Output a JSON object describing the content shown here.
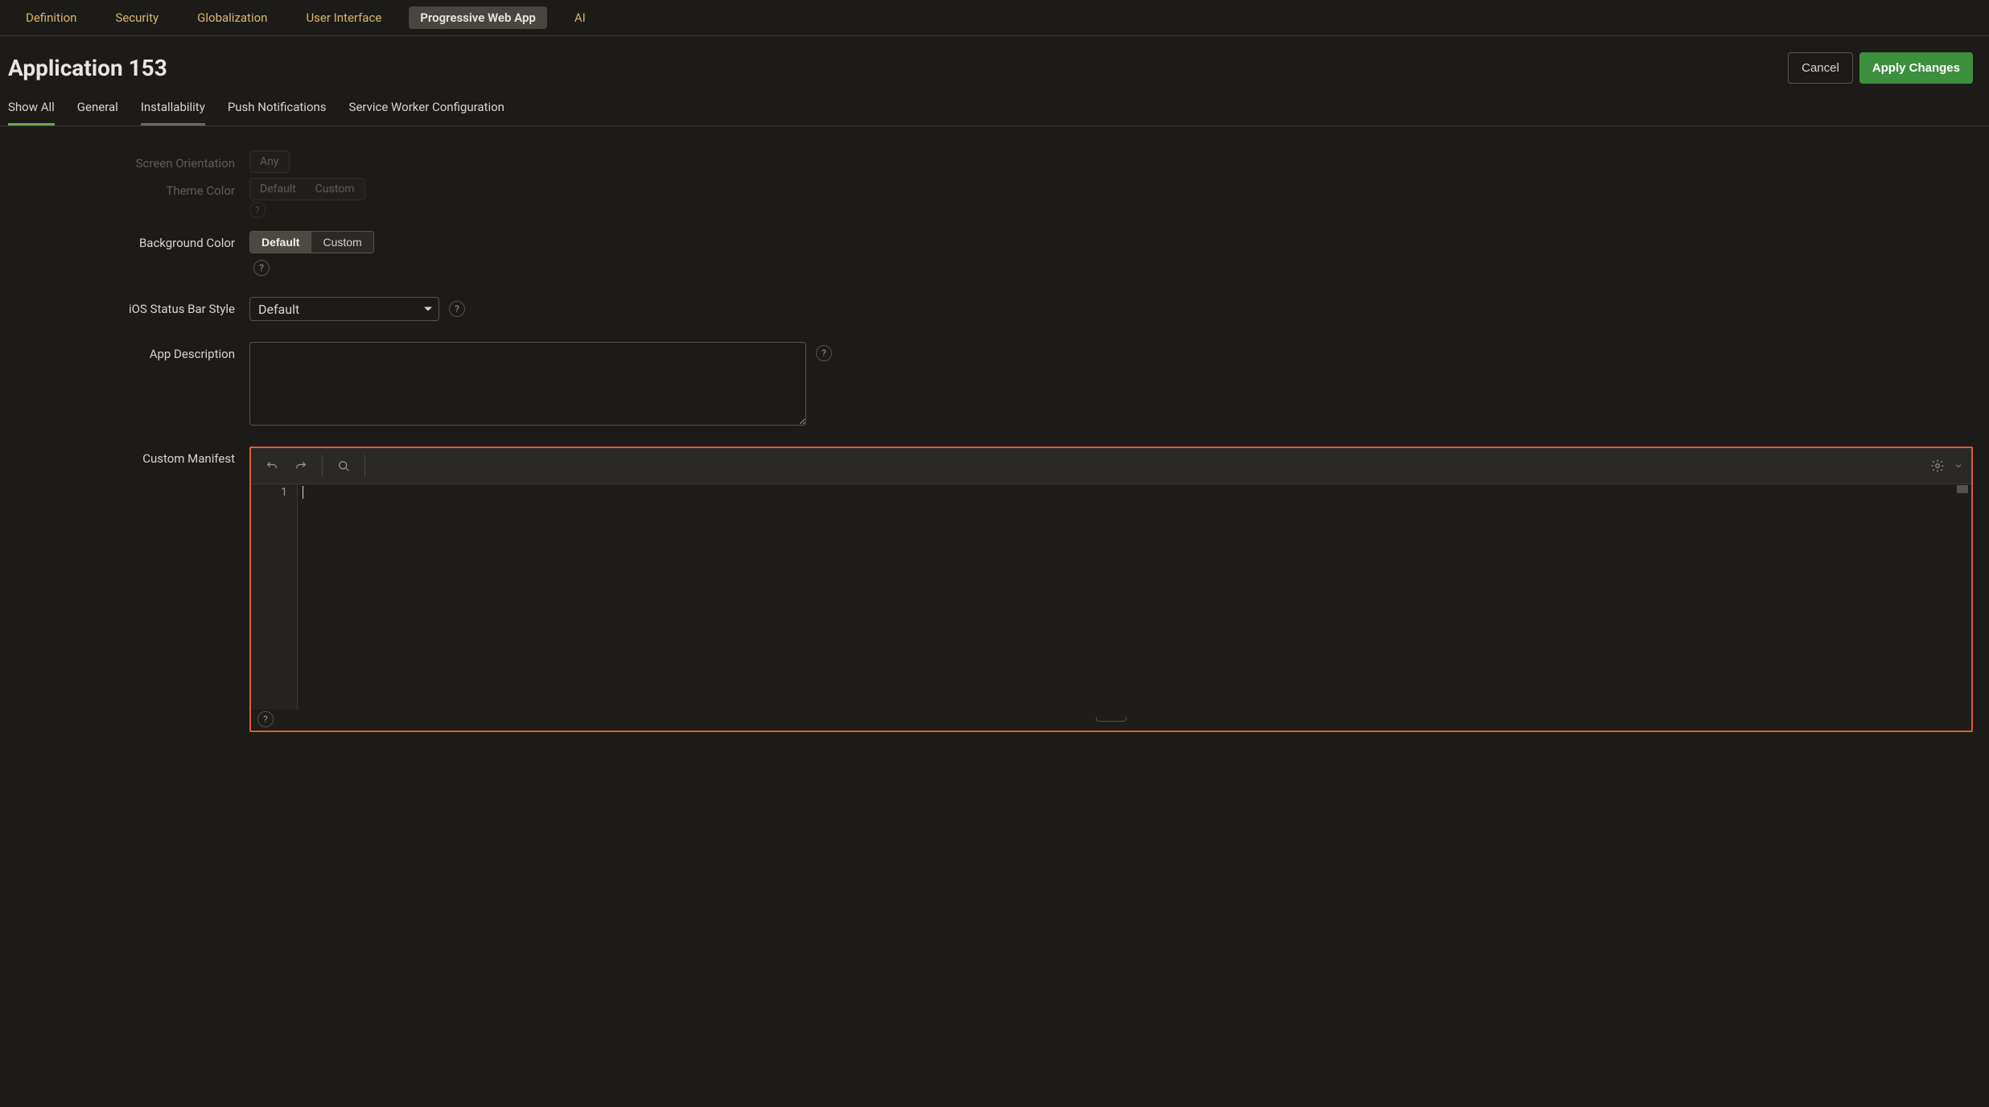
{
  "top_tabs": {
    "definition": "Definition",
    "security": "Security",
    "globalization": "Globalization",
    "user_interface": "User Interface",
    "pwa": "Progressive Web App",
    "ai": "AI"
  },
  "title": "Application 153",
  "buttons": {
    "cancel": "Cancel",
    "apply": "Apply Changes"
  },
  "sub_tabs": {
    "show_all": "Show All",
    "general": "General",
    "installability": "Installability",
    "push": "Push Notifications",
    "sw": "Service Worker Configuration"
  },
  "faded": {
    "orientation_label": "Screen Orientation",
    "any": "Any",
    "theme_label": "Theme Color",
    "default": "Default",
    "custom": "Custom"
  },
  "labels": {
    "background_color": "Background Color",
    "ios_status": "iOS Status Bar Style",
    "app_desc": "App Description",
    "custom_manifest": "Custom Manifest"
  },
  "segmented": {
    "default": "Default",
    "custom": "Custom"
  },
  "ios_status_value": "Default",
  "app_desc_value": "",
  "editor": {
    "line1": "1"
  },
  "help_glyph": "?"
}
